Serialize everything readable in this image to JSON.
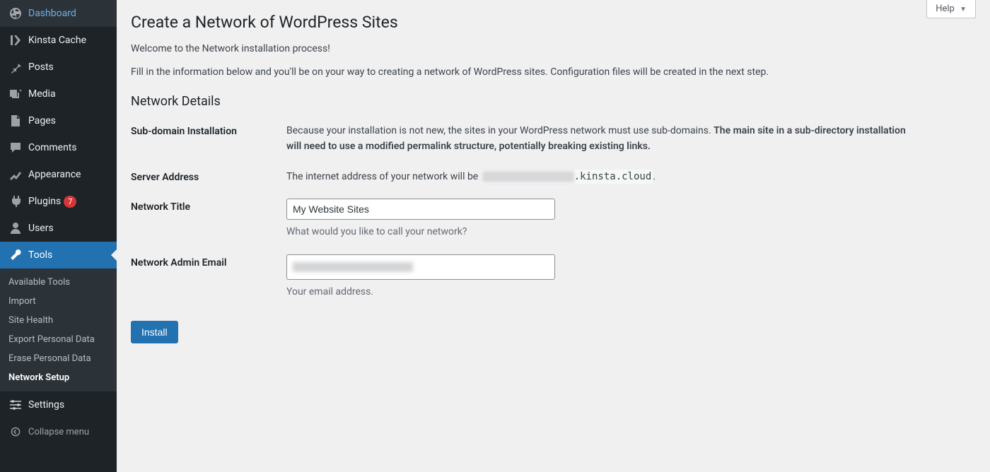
{
  "sidebar": {
    "items": [
      {
        "label": "Dashboard",
        "icon": "dashboard"
      },
      {
        "label": "Kinsta Cache",
        "icon": "kinsta"
      },
      {
        "label": "Posts",
        "icon": "pin"
      },
      {
        "label": "Media",
        "icon": "media"
      },
      {
        "label": "Pages",
        "icon": "pages"
      },
      {
        "label": "Comments",
        "icon": "comments"
      },
      {
        "label": "Appearance",
        "icon": "appearance"
      },
      {
        "label": "Plugins",
        "icon": "plugins",
        "badge": "7"
      },
      {
        "label": "Users",
        "icon": "users"
      },
      {
        "label": "Tools",
        "icon": "tools",
        "current": true
      }
    ],
    "submenu": [
      {
        "label": "Available Tools"
      },
      {
        "label": "Import"
      },
      {
        "label": "Site Health"
      },
      {
        "label": "Export Personal Data"
      },
      {
        "label": "Erase Personal Data"
      },
      {
        "label": "Network Setup",
        "current": true
      }
    ],
    "items2": [
      {
        "label": "Settings",
        "icon": "settings"
      }
    ],
    "collapse_label": "Collapse menu"
  },
  "help_label": "Help",
  "page": {
    "title": "Create a Network of WordPress Sites",
    "welcome": "Welcome to the Network installation process!",
    "intro": "Fill in the information below and you'll be on your way to creating a network of WordPress sites. Configuration files will be created in the next step.",
    "details_heading": "Network Details",
    "rows": {
      "subdomain": {
        "label": "Sub-domain Installation",
        "text_pre": "Because your installation is not new, the sites in your WordPress network must use sub-domains. ",
        "text_bold": "The main site in a sub-directory installation will need to use a modified permalink structure, potentially breaking existing links."
      },
      "server": {
        "label": "Server Address",
        "text_pre": "The internet address of your network will be ",
        "domain_suffix": ".kinsta.cloud",
        "text_post": "."
      },
      "title": {
        "label": "Network Title",
        "value": "My Website Sites",
        "desc": "What would you like to call your network?"
      },
      "email": {
        "label": "Network Admin Email",
        "value": "",
        "desc": "Your email address."
      }
    },
    "install_label": "Install"
  }
}
